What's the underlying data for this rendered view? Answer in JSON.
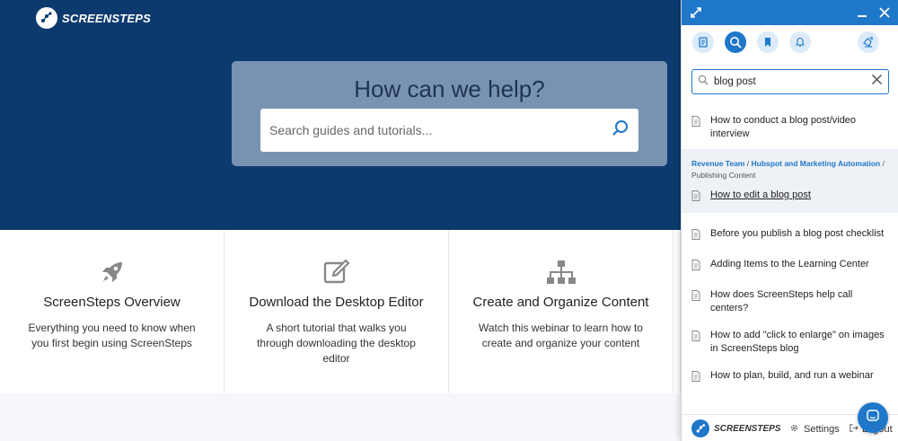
{
  "site": {
    "logo_text": "SCREENSTEPS",
    "hero_title": "How can we help?",
    "search_placeholder": "Search guides and tutorials...",
    "cards": [
      {
        "title": "ScreenSteps Overview",
        "desc": "Everything you need to know when you first begin using ScreenSteps",
        "icon": "rocket-icon"
      },
      {
        "title": "Download the Desktop Editor",
        "desc": "A short tutorial that walks you through downloading the desktop editor",
        "icon": "edit-icon"
      },
      {
        "title": "Create and Organize Content",
        "desc": "Watch this webinar to learn how to create and organize your content",
        "icon": "sitemap-icon"
      }
    ]
  },
  "panel": {
    "search_value": "blog post",
    "results_top": [
      {
        "title": "How to conduct a blog post/video interview"
      }
    ],
    "group": {
      "crumb_1": "Revenue Team",
      "crumb_2": "Hubspot and Marketing Automation",
      "crumb_3": "Publishing Content",
      "sep": "/",
      "result": "How to edit a blog post"
    },
    "results_bottom": [
      {
        "title": "Before you publish a blog post checklist"
      },
      {
        "title": "Adding Items to the Learning Center"
      },
      {
        "title": "How does ScreenSteps help call centers?"
      },
      {
        "title": "How to add \"click to enlarge\" on images in ScreenSteps blog"
      },
      {
        "title": "How to plan, build, and run a webinar"
      }
    ],
    "footer": {
      "logo_text": "SCREENSTEPS",
      "settings_label": "Settings",
      "logout_label": "Logout"
    }
  },
  "colors": {
    "hero": "#0d3a6e",
    "accent": "#1e77c9"
  }
}
